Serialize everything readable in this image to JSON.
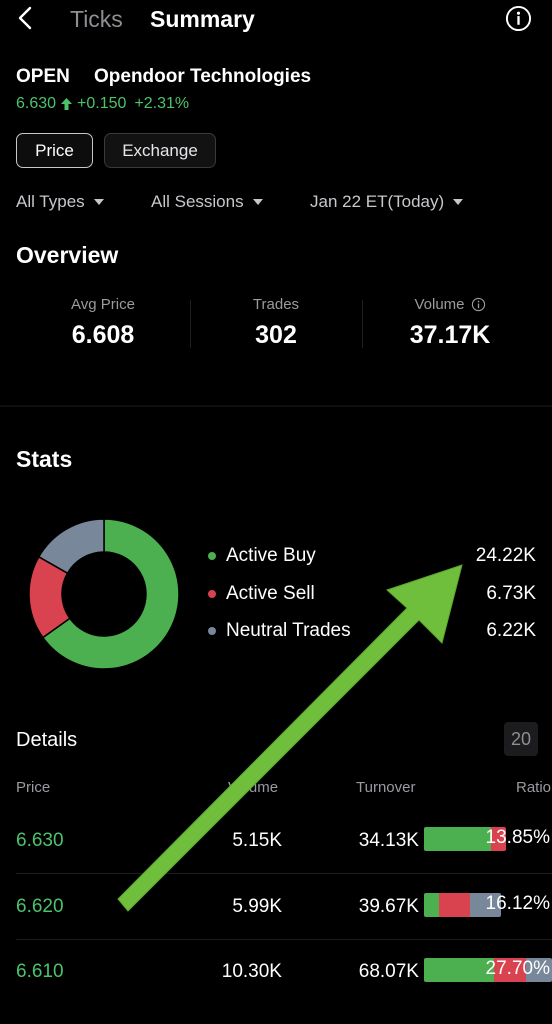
{
  "nav": {
    "tab_ticks": "Ticks",
    "tab_summary": "Summary"
  },
  "stock": {
    "symbol": "OPEN",
    "name": "Opendoor Technologies",
    "price": "6.630",
    "change": "+0.150",
    "change_pct": "+2.31%"
  },
  "toggles": {
    "price": "Price",
    "exchange": "Exchange"
  },
  "filters": {
    "types": "All Types",
    "sessions": "All Sessions",
    "date": "Jan 22 ET(Today)"
  },
  "overview": {
    "title": "Overview",
    "avg_price_label": "Avg Price",
    "avg_price": "6.608",
    "trades_label": "Trades",
    "trades": "302",
    "volume_label": "Volume",
    "volume": "37.17K"
  },
  "stats": {
    "title": "Stats",
    "items": [
      {
        "label": "Active Buy",
        "value": "24.22K",
        "color": "#4caf50",
        "fraction": 0.6515
      },
      {
        "label": "Active Sell",
        "value": "6.73K",
        "color": "#d9424f",
        "fraction": 0.1811
      },
      {
        "label": "Neutral Trades",
        "value": "6.22K",
        "color": "#78879a",
        "fraction": 0.1674
      }
    ]
  },
  "details": {
    "title": "Details",
    "page_size": "20",
    "headers": {
      "price": "Price",
      "volume": "Volume",
      "turnover": "Turnover",
      "ratio": "Ratio"
    },
    "rows": [
      {
        "price": "6.630",
        "volume": "5.15K",
        "turnover": "34.13K",
        "ratio": "13.85%",
        "buy": 0.52,
        "sell": 0.12,
        "neutral": 0.0
      },
      {
        "price": "6.620",
        "volume": "5.99K",
        "turnover": "39.67K",
        "ratio": "16.12%",
        "buy": 0.12,
        "sell": 0.24,
        "neutral": 0.24
      },
      {
        "price": "6.610",
        "volume": "10.30K",
        "turnover": "68.07K",
        "ratio": "27.70%",
        "buy": 0.55,
        "sell": 0.25,
        "neutral": 0.2
      }
    ]
  },
  "colors": {
    "up": "#4cc36b",
    "arrow": "#6fbf3c"
  }
}
